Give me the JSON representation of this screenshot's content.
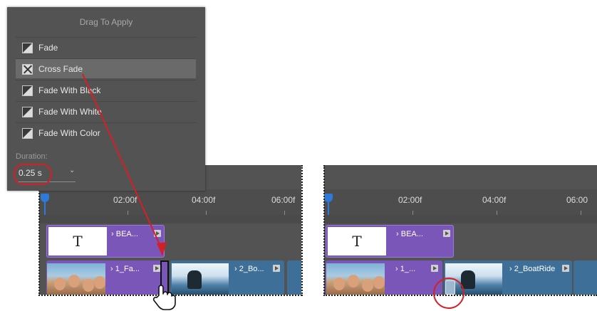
{
  "transitions_panel": {
    "title": "Drag To Apply",
    "items": [
      {
        "label": "Fade",
        "icon": "fade-icon"
      },
      {
        "label": "Cross Fade",
        "icon": "cross-fade-icon",
        "selected": true
      },
      {
        "label": "Fade With Black",
        "icon": "fade-icon"
      },
      {
        "label": "Fade With White",
        "icon": "fade-icon"
      },
      {
        "label": "Fade With Color",
        "icon": "fade-icon"
      }
    ],
    "duration_label": "Duration:",
    "duration_value": "0.25 s"
  },
  "timeline_before": {
    "ruler": [
      "02:00f",
      "04:00f",
      "06:00f"
    ],
    "title_clip": {
      "thumb_text": "T",
      "label": "BEA..."
    },
    "video_clips": [
      {
        "label": "1_Fa..."
      },
      {
        "label": "2_Bo..."
      }
    ]
  },
  "timeline_after": {
    "ruler": [
      "02:00f",
      "04:00f",
      "06:00"
    ],
    "title_clip": {
      "thumb_text": "T",
      "label": "BEA..."
    },
    "video_clips": [
      {
        "label": "1_..."
      },
      {
        "label": "2_BoatRide"
      }
    ]
  },
  "colors": {
    "annotation_red": "#d32026",
    "title_clip_purple": "#7a56b8",
    "video_clip_blue": "#3d6f99",
    "playhead_blue": "#2f7ad8"
  }
}
